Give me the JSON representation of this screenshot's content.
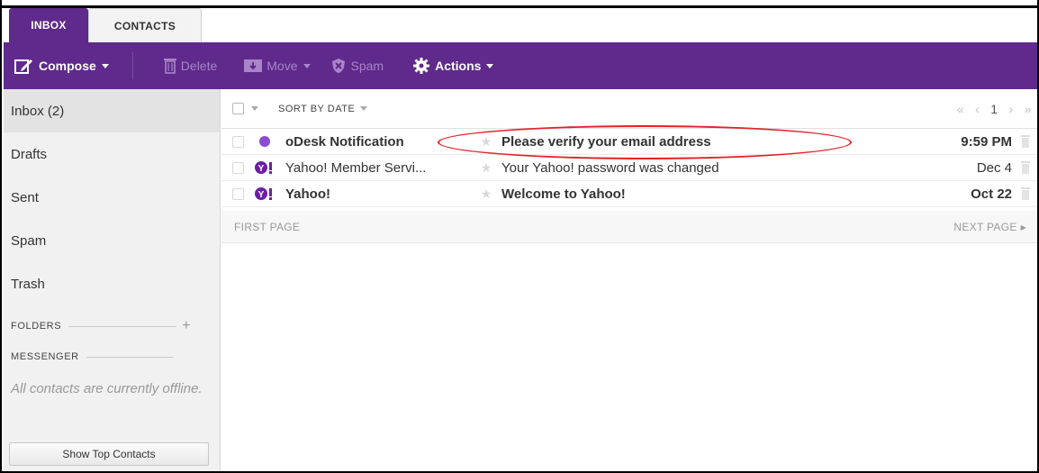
{
  "tabs": [
    {
      "label": "INBOX"
    },
    {
      "label": "CONTACTS"
    }
  ],
  "toolbar": {
    "compose_label": "Compose",
    "delete_label": "Delete",
    "move_label": "Move",
    "spam_label": "Spam",
    "actions_label": "Actions"
  },
  "sidebar": {
    "items": [
      {
        "label": "Inbox (2)"
      },
      {
        "label": "Drafts"
      },
      {
        "label": "Sent"
      },
      {
        "label": "Spam"
      },
      {
        "label": "Trash"
      }
    ],
    "folders_label": "FOLDERS",
    "messenger_label": "MESSENGER",
    "offline_text": "All contacts are currently offline.",
    "show_top_contacts_label": "Show Top Contacts"
  },
  "list": {
    "sort_label": "SORT BY DATE",
    "page_number": "1",
    "first_page_label": "FIRST PAGE",
    "next_page_label": "NEXT PAGE",
    "messages": [
      {
        "from": "oDesk Notification",
        "subject": "Please verify your email address",
        "date": "9:59 PM",
        "unread": true,
        "icon": "purple-dot-icon"
      },
      {
        "from": "Yahoo! Member Servi...",
        "subject": "Your Yahoo! password was changed",
        "date": "Dec 4",
        "unread": false,
        "icon": "yahoo-logo-icon"
      },
      {
        "from": "Yahoo!",
        "subject": "Welcome to Yahoo!",
        "date": "Oct 22",
        "unread": true,
        "icon": "yahoo-logo-icon"
      }
    ]
  },
  "colors": {
    "brand": "#5f2a8c",
    "annotation": "#e4202a"
  }
}
